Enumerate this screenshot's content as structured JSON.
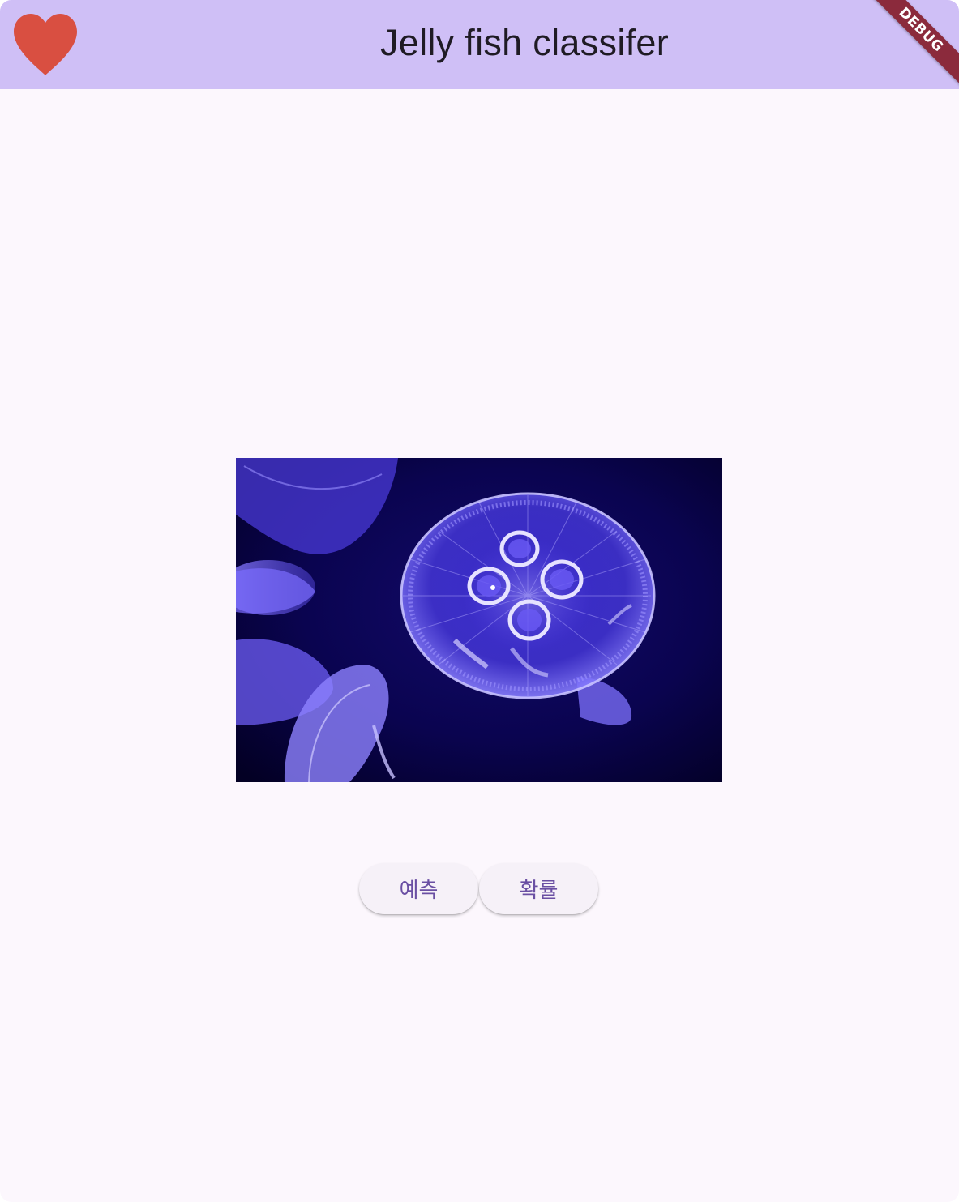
{
  "appbar": {
    "title": "Jelly fish classifer",
    "heart_icon": "heart-icon",
    "heart_color": "#d94f41",
    "background": "#cfbff6"
  },
  "debug_banner": {
    "label": "DEBUG",
    "color": "#8b2a3c"
  },
  "main": {
    "image": {
      "subject": "moon jellyfish photo",
      "accent": "#5a4cf0"
    },
    "buttons": {
      "predict_label": "예측",
      "probability_label": "확률"
    }
  }
}
